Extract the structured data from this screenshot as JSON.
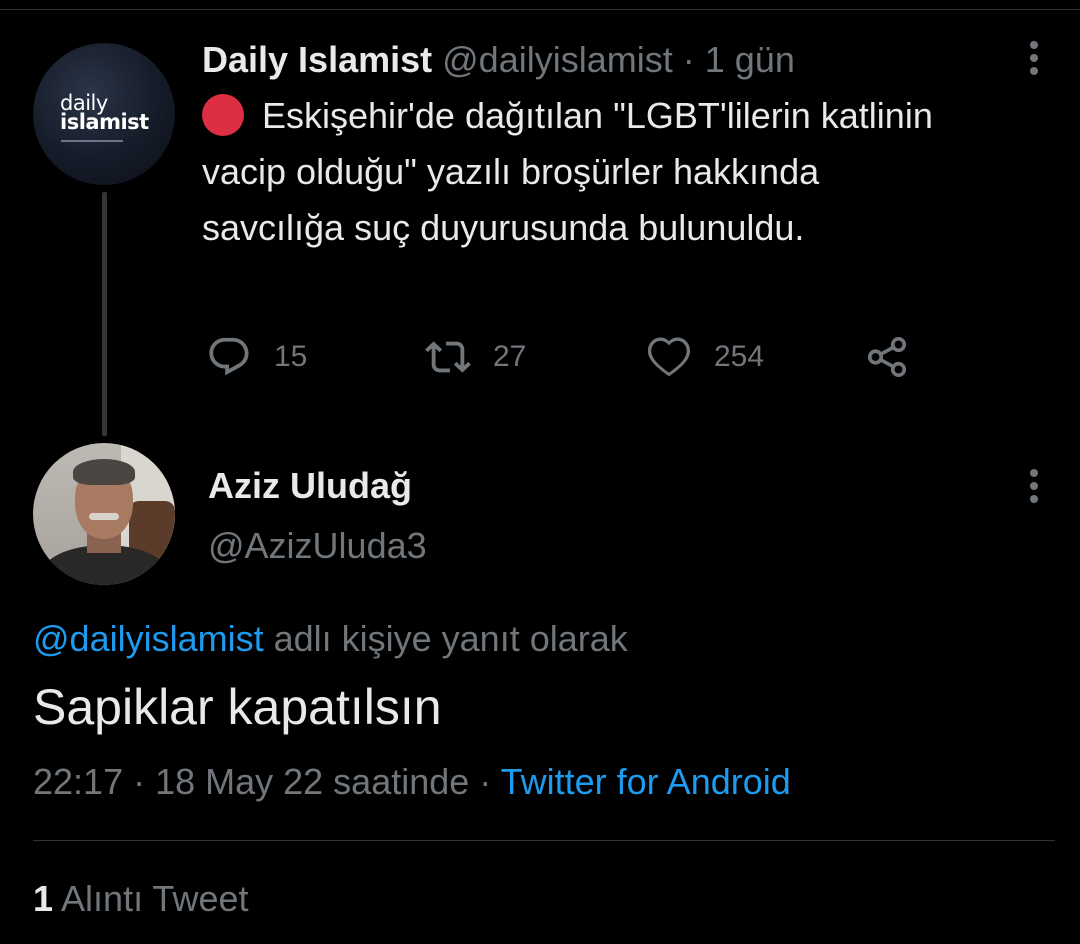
{
  "parent_tweet": {
    "avatar": {
      "logo_line1": "daily",
      "logo_line2": "islamist"
    },
    "display_name": "Daily Islamist",
    "handle": "@dailyislamist",
    "separator": "·",
    "time": "1 gün",
    "indicator_icon": "red-circle-icon",
    "text": "Eskişehir'de dağıtılan \"LGBT'lilerin katlinin vacip olduğu\" yazılı broşürler hakkında savcılığa suç duyurusunda bulunuldu.",
    "more_icon": "more-vertical-icon",
    "actions": {
      "reply": {
        "icon": "reply-icon",
        "count": "15"
      },
      "retweet": {
        "icon": "retweet-icon",
        "count": "27"
      },
      "like": {
        "icon": "heart-icon",
        "count": "254"
      },
      "share": {
        "icon": "share-icon"
      }
    }
  },
  "reply_tweet": {
    "display_name": "Aziz Uludağ",
    "handle": "@AzizUluda3",
    "more_icon": "more-vertical-icon",
    "context_mention": "@dailyislamist",
    "context_suffix": " adlı kişiye yanıt olarak",
    "text": "Sapiklar kapatılsın",
    "timestamp": "22:17 · 18 May 22 saatinde",
    "meta_separator": " · ",
    "source": "Twitter for Android"
  },
  "quotes": {
    "count": "1",
    "label": " Alıntı Tweet"
  },
  "colors": {
    "background": "#000000",
    "primary_text": "#e7e9ea",
    "secondary_text": "#71767b",
    "link": "#1d9bf0",
    "divider": "#2f3336",
    "red_dot": "#dd2e44"
  }
}
